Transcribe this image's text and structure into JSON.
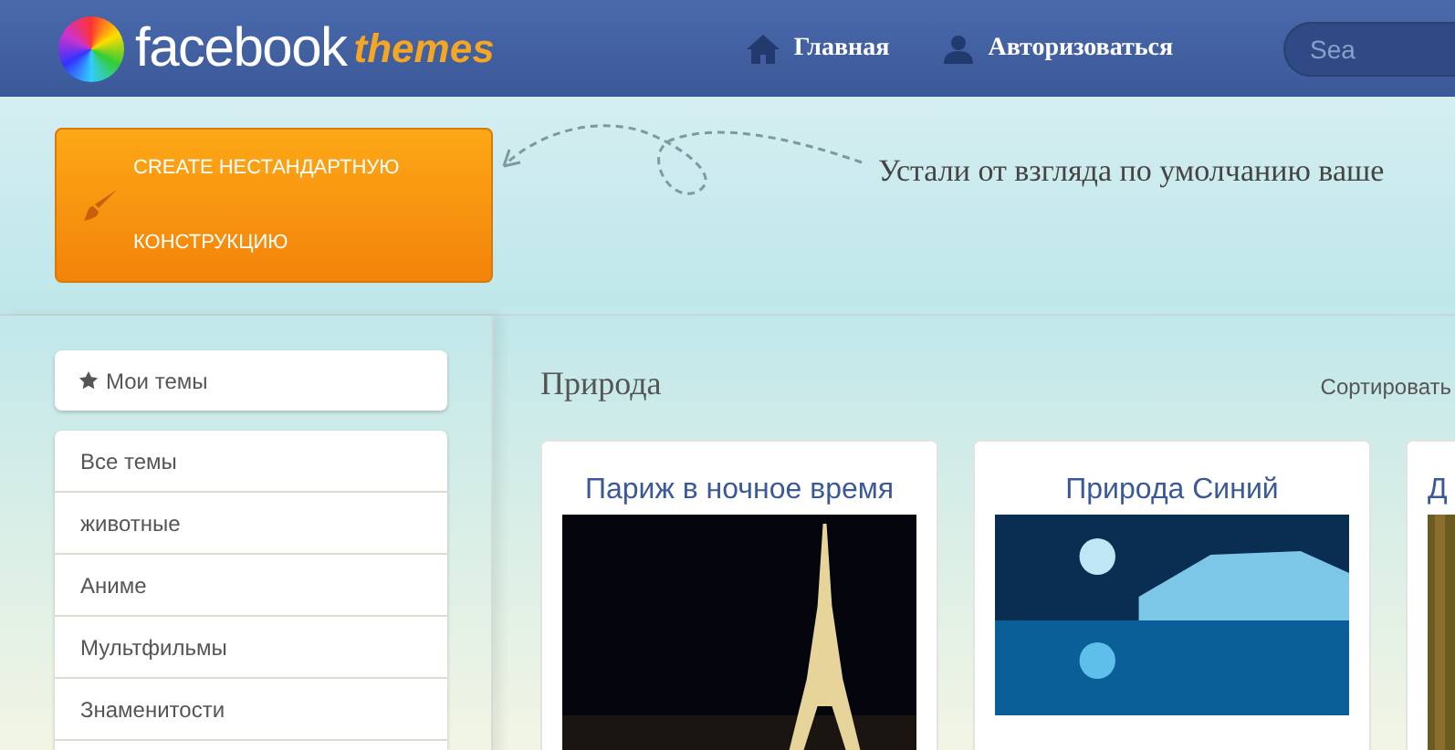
{
  "header": {
    "logo_word": "facebook",
    "logo_accent": "themes",
    "nav": [
      {
        "label": "Главная",
        "kind": "home"
      },
      {
        "label": "Авторизоваться",
        "kind": "user"
      }
    ],
    "search": {
      "placeholder": "Sea"
    }
  },
  "banner": {
    "button": "CREATE НЕСТАНДАРТНУЮ КОНСТРУКЦИЮ",
    "tagline": "Устали от взгляда по умолчанию ваше"
  },
  "sidebar": {
    "my_themes": "Мои темы",
    "items": [
      "Все темы",
      "животные",
      "Аниме",
      "Мультфильмы",
      "Знаменитости"
    ]
  },
  "content": {
    "title": "Природа",
    "sort_label": "Сортировать",
    "cards": [
      {
        "title": "Париж в ночное время",
        "kind": "eiffel"
      },
      {
        "title": "Природа Синий",
        "kind": "lake"
      },
      {
        "title": "Д",
        "kind": "forest"
      }
    ]
  }
}
